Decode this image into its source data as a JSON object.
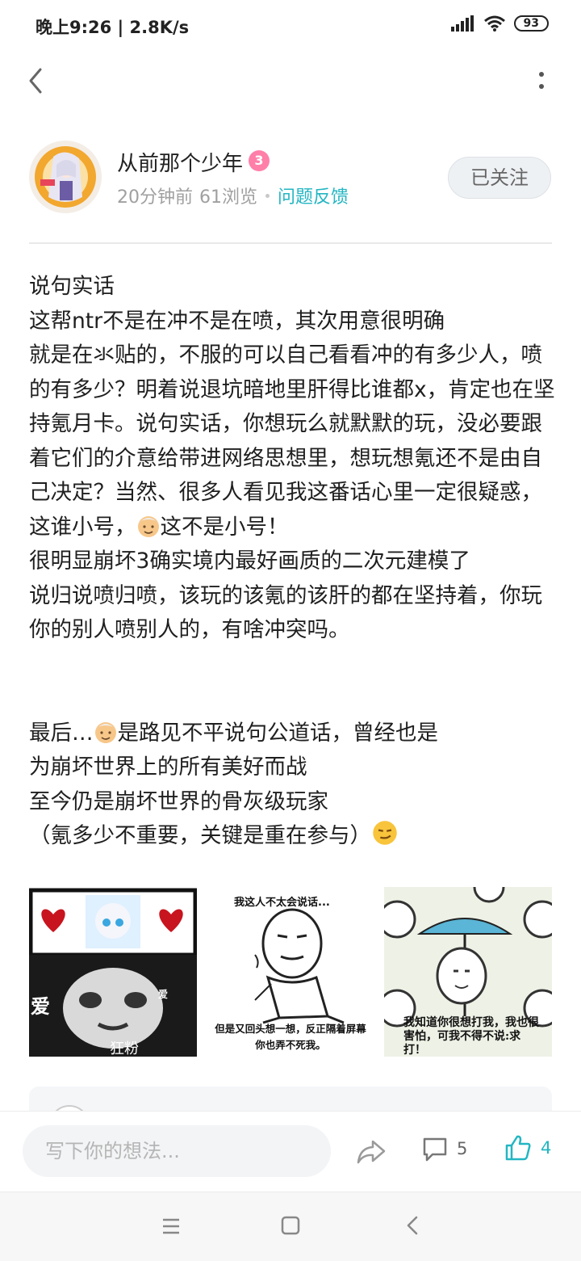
{
  "status": {
    "time": "晚上9:26 | 2.8K/s",
    "battery": "93"
  },
  "author": {
    "name": "从前那个少年",
    "level": "3",
    "time": "20分钟前",
    "views": "61浏览",
    "category": "问题反馈",
    "follow_label": "已关注"
  },
  "post": {
    "paragraph_1_lines": [
      "说句实话",
      "这帮ntr不是在冲不是在喷，其次用意很明确"
    ],
    "paragraph_2": "就是在氺贴的，不服的可以自己看看冲的有多少人，喷的有多少？明着说退坑暗地里肝得比谁都x，肯定也在坚持氪月卡。说句实话，你想玩么就默默的玩，没必要跟着它们的介意给带进网络思想里，想玩想氪还不是由自己决定？当然、很多人看见我这番话心里一定很疑惑，这谁小号，",
    "paragraph_2_tail": "这不是小号！",
    "paragraph_3_lines": [
      "很明显崩坏3确实境内最好画质的二次元建模了",
      "说归说喷归喷，该玩的该氪的该肝的都在坚持着，你玩你的别人喷别人的，有啥冲突吗。"
    ],
    "ending_prefix": "最后…",
    "ending_line1_rest": "是路见不平说句公道话，曾经也是",
    "ending_lines": [
      "为崩坏世界上的所有美好而战",
      "至今仍是崩坏世界的骨灰级玩家"
    ],
    "ending_last": "（氪多少不重要，关键是重在参与）"
  },
  "images": {
    "meme1_text_left": "爱",
    "meme1_text_right": "爱",
    "meme1_caption": "狂粉",
    "meme2_top": "我这人不太会说话...",
    "meme2_bottom": "但是又回头想一想，反正隔着屏幕你也弄不死我。",
    "meme3_caption": "我知道你很想打我，我也很害怕，可我不得不说:求 打！"
  },
  "comment_preview": {
    "name": ""
  },
  "actions": {
    "input_placeholder": "写下你的想法...",
    "comment_count": "5",
    "like_count": "4"
  },
  "icons": [
    "back-arrow-icon",
    "more-icon",
    "level-badge-icon",
    "share-icon",
    "comment-icon",
    "thumbs-up-icon",
    "elder-emoji-icon",
    "smirk-emoji-icon",
    "nav-menu-icon",
    "nav-home-icon",
    "nav-back-icon",
    "signal-icon",
    "wifi-icon"
  ],
  "colors": {
    "accent": "#23b6c2",
    "badge": "#ff7fa9",
    "text": "#1f1f1f",
    "muted": "#a0a0a0"
  }
}
